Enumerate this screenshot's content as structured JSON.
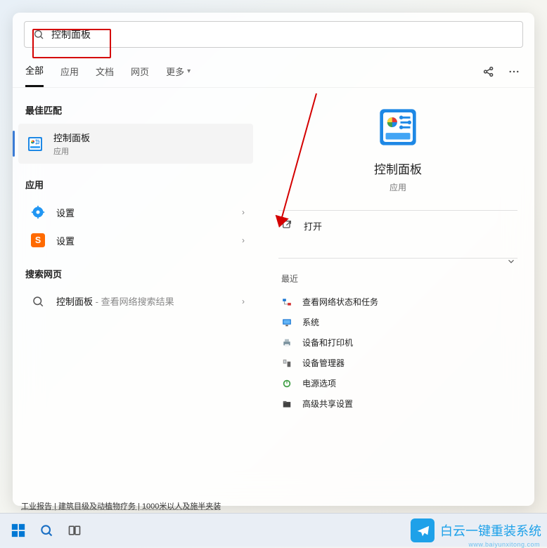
{
  "search": {
    "value": "控制面板"
  },
  "tabs": {
    "all": "全部",
    "apps": "应用",
    "docs": "文档",
    "web": "网页",
    "more": "更多"
  },
  "left": {
    "best_header": "最佳匹配",
    "best": {
      "title": "控制面板",
      "sub": "应用"
    },
    "apps_header": "应用",
    "apps": [
      {
        "title": "设置",
        "icon": "gear"
      },
      {
        "title": "设置",
        "icon": "sogou"
      }
    ],
    "web_header": "搜索网页",
    "web": {
      "title": "控制面板",
      "suffix": " - 查看网络搜索结果"
    }
  },
  "detail": {
    "title": "控制面板",
    "sub": "应用",
    "open_label": "打开",
    "recent_header": "最近",
    "recent": [
      "查看网络状态和任务",
      "系统",
      "设备和打印机",
      "设备管理器",
      "电源选项",
      "高级共享设置"
    ]
  },
  "bottom_text": "工业报告 | 建筑目级及动植物疗务 | 1000米以人及施半夹装",
  "watermark": {
    "text": "白云一键重装系统",
    "url": "www.baiyunxitong.com"
  }
}
